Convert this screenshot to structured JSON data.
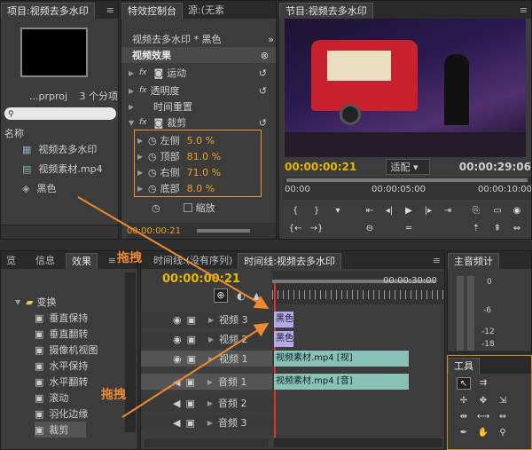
{
  "project": {
    "tab": "项目:视频去多水印",
    "filename": "...prproj",
    "count": "3 个分项",
    "search_placeholder": "",
    "col_name": "名称",
    "items": [
      "视频去多水印",
      "视频素材.mp4",
      "黑色"
    ]
  },
  "effect_controls": {
    "tab": "特效控制台",
    "tab2": "源:(无素",
    "clip_label": "视频去多水印 * 黑色",
    "section": "视频效果",
    "motion": "运动",
    "opacity": "透明度",
    "time_remap": "时间重置",
    "crop": "裁剪",
    "left_label": "左侧",
    "left_val": "5.0 %",
    "top_label": "顶部",
    "top_val": "81.0 %",
    "right_label": "右侧",
    "right_val": "71.0 %",
    "bottom_label": "底部",
    "bottom_val": "8.0 %",
    "zoom": "缩放",
    "timecode": "00:00:00:21"
  },
  "program": {
    "tab": "节目:视频去多水印",
    "current_time": "00:00:00:21",
    "fit": "适配",
    "duration": "00:00:29:06",
    "ruler": [
      "00:00",
      "00:00:05:00",
      "00:00:10:00"
    ]
  },
  "effects_panel": {
    "tabs": [
      "览",
      "信息",
      "效果"
    ],
    "group": "变换",
    "items": [
      "垂直保持",
      "垂直翻转",
      "摄像机视图",
      "水平保持",
      "水平翻转",
      "滚动",
      "羽化边缘",
      "裁剪"
    ]
  },
  "timeline": {
    "tab_inactive": "时间线:(没有序列)",
    "tab_active": "时间线:视频去多水印",
    "timecode": "00:00:00:21",
    "ruler_end": "00:00:30:00",
    "tracks": [
      "视频 3",
      "视频 2",
      "视频 1",
      "音频 1",
      "音频 2",
      "音频 3"
    ],
    "clips": {
      "v3": "黑色",
      "v2": "黑色",
      "v1": "视频素材.mp4 [视]",
      "a1": "视频素材.mp4 [音]"
    }
  },
  "audio_meter": {
    "tab": "主音频计",
    "scale": [
      "0",
      "-6",
      "-12",
      "-18"
    ]
  },
  "tools": {
    "tab": "工具"
  },
  "annotations": {
    "drag1": "拖拽",
    "drag2": "拖拽"
  },
  "colors": {
    "accent": "#f0a020",
    "clip": "#89c1b6",
    "purple": "#b6a8e8",
    "arrow": "#f08a30"
  }
}
